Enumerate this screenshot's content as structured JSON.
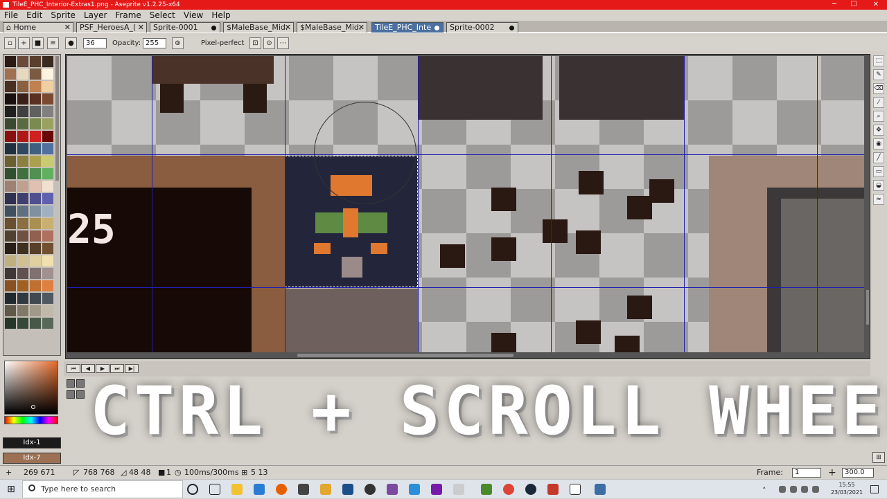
{
  "window": {
    "title": "TileE_PHC_Interior-Extras1.png - Aseprite v1.2.25-x64",
    "minimize": "─",
    "maximize": "☐",
    "close": "✕"
  },
  "menu": [
    "File",
    "Edit",
    "Sprite",
    "Layer",
    "Frame",
    "Select",
    "View",
    "Help"
  ],
  "tabs": [
    {
      "label": "Home",
      "marker": "✕"
    },
    {
      "label": "PSF_HeroesA_(",
      "marker": "✕"
    },
    {
      "label": "Sprite-0001",
      "marker": "dot"
    },
    {
      "label": "$MaleBase_Mid.",
      "marker": "✕"
    },
    {
      "label": "$MaleBase_Mid.",
      "marker": "✕"
    },
    {
      "label": "TileE_PHC_Inte",
      "marker": "dot"
    },
    {
      "label": "Sprite-0002",
      "marker": "dot"
    }
  ],
  "context_bar": {
    "brush_size": "36",
    "opacity_label": "Opacity:",
    "opacity_value": "255",
    "pixel_perfect_label": "Pixel-perfect"
  },
  "palette_colors": [
    "#2b1b14",
    "#6a4a3a",
    "#5a3e2e",
    "#3a2a20",
    "#a07050",
    "#e8d8c0",
    "#7a5a40",
    "#fff4e0",
    "#4a3020",
    "#8a6040",
    "#c08050",
    "#f0d0a0",
    "#1a1010",
    "#3a2018",
    "#5a3020",
    "#7a4a30",
    "#202020",
    "#404040",
    "#606060",
    "#808080",
    "#3a4a30",
    "#5a6a40",
    "#7a8a50",
    "#9aa060",
    "#8a1010",
    "#b01818",
    "#d02020",
    "#6a0808",
    "#203040",
    "#304860",
    "#406080",
    "#5070a0",
    "#6a6030",
    "#8a8040",
    "#aaa050",
    "#caca70",
    "#305030",
    "#407040",
    "#509050",
    "#60b060",
    "#a08070",
    "#c0a090",
    "#e0c0b0",
    "#f0e0d0",
    "#303050",
    "#404070",
    "#505090",
    "#6060b0",
    "#405060",
    "#607080",
    "#8090a0",
    "#a0b0c0",
    "#6a5030",
    "#8a7040",
    "#aa9050",
    "#cab070",
    "#504030",
    "#705040",
    "#906050",
    "#b07060",
    "#282018",
    "#403020",
    "#584028",
    "#705030",
    "#c0b080",
    "#d0c090",
    "#e0d0a0",
    "#f0e0b0",
    "#403838",
    "#605050",
    "#807070",
    "#a09090",
    "#8a5020",
    "#a06020",
    "#c07030",
    "#e08040",
    "#202830",
    "#303840",
    "#404850",
    "#505860",
    "#605848",
    "#807868",
    "#a09888",
    "#c0b8a8",
    "#283828",
    "#384838",
    "#485848",
    "#586858"
  ],
  "color_slots": {
    "foreground": "Idx-1",
    "background": "Idx-7",
    "foreground_color": "#1b1b1b",
    "background_color": "#9c7053"
  },
  "timeline": {
    "controls": [
      "⏮",
      "◀",
      "▶",
      "⏭"
    ]
  },
  "overlay_text": "CTRL + SCROLL WHEEL",
  "status": {
    "cursor_pos": "269 671",
    "sprite_size": "768 768",
    "grid_size": "48 48",
    "frames": "1",
    "duration": "100ms/300ms",
    "selection": "5 13",
    "frame_label": "Frame:",
    "frame_value": "1",
    "zoom_value": "300.0"
  },
  "taskbar": {
    "search_placeholder": "Type here to search",
    "time": "15:55",
    "date": "23/03/2021"
  }
}
